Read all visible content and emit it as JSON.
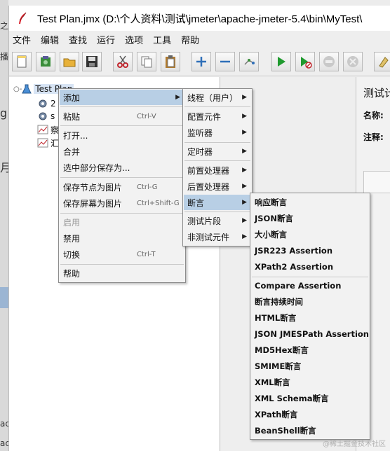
{
  "window": {
    "title": "Test Plan.jmx (D:\\个人资料\\测试\\jmeter\\apache-jmeter-5.4\\bin\\MyTest\\"
  },
  "menubar": [
    "文件",
    "编辑",
    "查找",
    "运行",
    "选项",
    "工具",
    "帮助"
  ],
  "toolbar_icons": [
    "new-icon",
    "templates-icon",
    "open-icon",
    "save-icon",
    "cut-icon",
    "copy-icon",
    "paste-icon",
    "expand-icon",
    "collapse-icon",
    "toggle-icon",
    "start-icon",
    "start-no-pause-icon",
    "stop-icon",
    "shutdown-icon",
    "clear-icon"
  ],
  "background_fragments": [
    "之",
    "播",
    "g",
    "月",
    "ac",
    "ac"
  ],
  "tree": {
    "root": "Test Plan",
    "children": [
      "2",
      "s",
      "察",
      "汇"
    ]
  },
  "right_panel": {
    "title": "测试计",
    "name_label": "名称:",
    "comment_label": "注释:"
  },
  "context_menu": {
    "items": [
      {
        "label": "添加",
        "shortcut": "",
        "submenu": true
      },
      {
        "label": "粘贴",
        "shortcut": "Ctrl-V"
      },
      {
        "label": "打开...",
        "shortcut": ""
      },
      {
        "label": "合并",
        "shortcut": ""
      },
      {
        "label": "选中部分保存为...",
        "shortcut": ""
      },
      {
        "label": "保存节点为图片",
        "shortcut": "Ctrl-G"
      },
      {
        "label": "保存屏幕为图片",
        "shortcut": "Ctrl+Shift-G"
      },
      {
        "label": "启用",
        "shortcut": ""
      },
      {
        "label": "禁用",
        "shortcut": ""
      },
      {
        "label": "切换",
        "shortcut": "Ctrl-T"
      },
      {
        "label": "帮助",
        "shortcut": ""
      }
    ]
  },
  "add_submenu": {
    "items": [
      "线程（用户）",
      "配置元件",
      "监听器",
      "定时器",
      "前置处理器",
      "后置处理器",
      "断言",
      "测试片段",
      "非测试元件"
    ]
  },
  "assertion_submenu": {
    "items": [
      "响应断言",
      "JSON断言",
      "大小断言",
      "JSR223 Assertion",
      "XPath2 Assertion",
      "Compare Assertion",
      "断言持续时间",
      "HTML断言",
      "JSON JMESPath Assertion",
      "MD5Hex断言",
      "SMIME断言",
      "XML断言",
      "XML Schema断言",
      "XPath断言",
      "BeanShell断言"
    ]
  },
  "watermark": "@稀土掘金技术社区"
}
